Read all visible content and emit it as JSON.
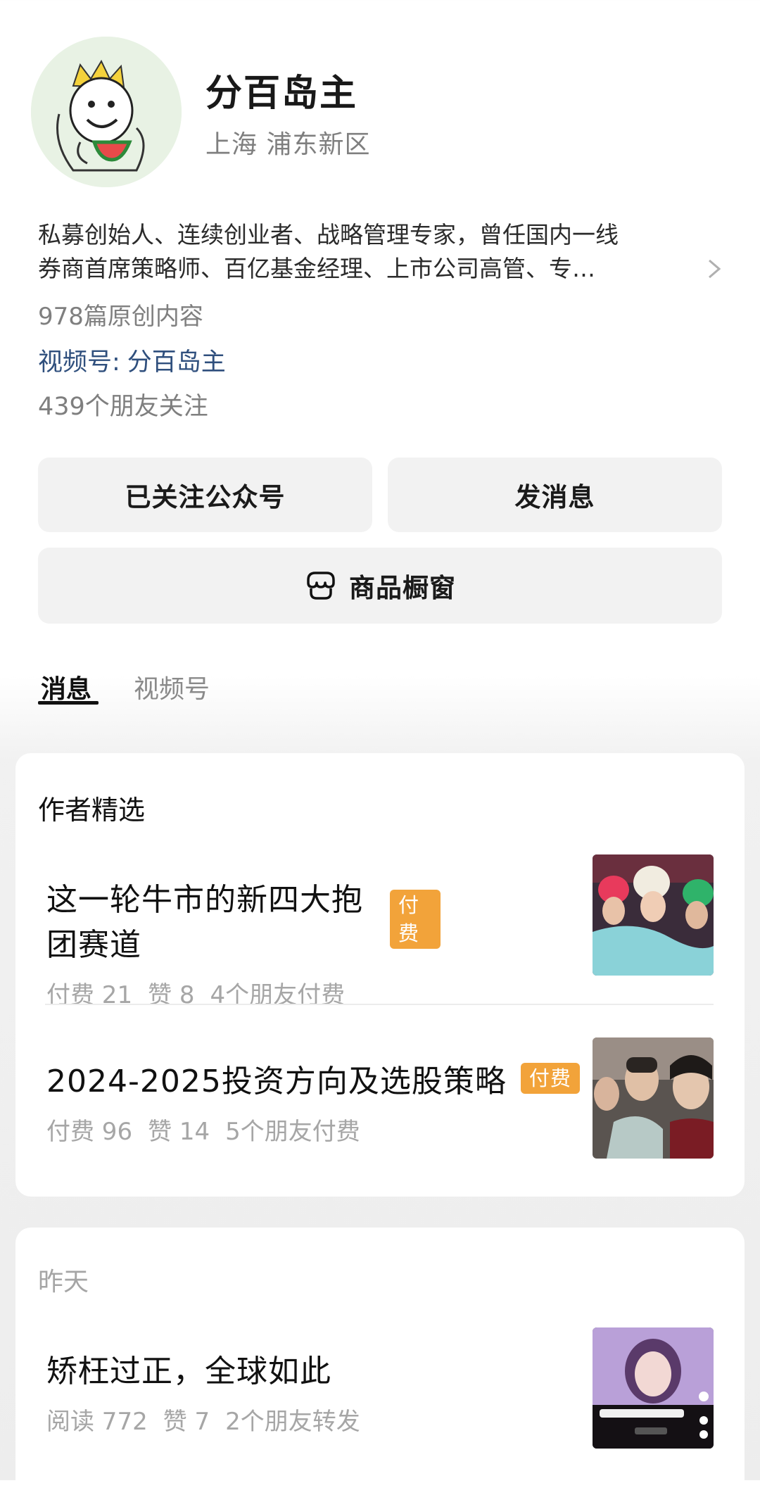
{
  "profile": {
    "name": "分百岛主",
    "location": "上海 浦东新区",
    "bio_line1": "私募创始人、连续创业者、战略管理专家，曾任国内一线",
    "bio_line2": "券商首席策略师、百亿基金经理、上市公司高管、专…",
    "articles_count": "978篇原创内容",
    "channel_label": "视频号:",
    "channel_name": "分百岛主",
    "friends_following": "439个朋友关注"
  },
  "actions": {
    "follow_label": "已关注公众号",
    "message_label": "发消息",
    "shop_label": "商品橱窗"
  },
  "tabs": [
    {
      "label": "消息",
      "active": true
    },
    {
      "label": "视频号",
      "active": false
    }
  ],
  "featured": {
    "title": "作者精选",
    "items": [
      {
        "title": "这一轮牛市的新四大抱团赛道",
        "badge": "付费",
        "paid": "付费 21",
        "likes": "赞 8",
        "friends": "4个朋友付费"
      },
      {
        "title": "2024-2025投资方向及选股策略",
        "badge": "付费",
        "paid": "付费 96",
        "likes": "赞 14",
        "friends": "5个朋友付费"
      }
    ]
  },
  "recent": {
    "title": "昨天",
    "items": [
      {
        "title": "矫枉过正，全球如此",
        "reads": "阅读 772",
        "likes": "赞 7",
        "friends": "2个朋友转发"
      }
    ]
  },
  "colors": {
    "badge": "#f2a33a",
    "channel_link": "#2f4f7d",
    "muted_text": "#a6a6a6"
  }
}
